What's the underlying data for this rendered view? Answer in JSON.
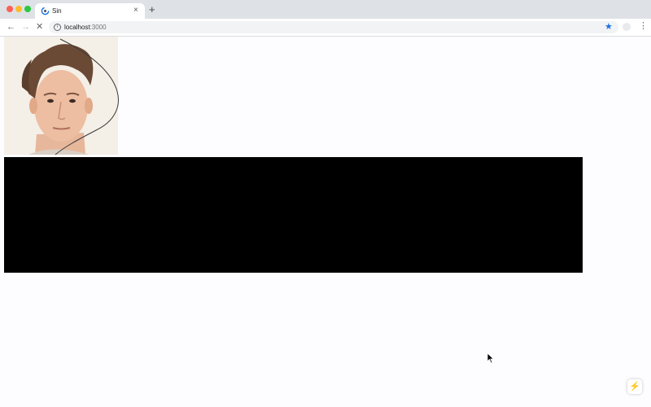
{
  "browser": {
    "tab": {
      "title": "Sin",
      "close_glyph": "×",
      "favicon": "loading-favicon-icon"
    },
    "new_tab_glyph": "+",
    "toolbar": {
      "back_glyph": "←",
      "forward_glyph": "→",
      "stop_glyph": "✕",
      "info_glyph": "i",
      "url_host": "localhost",
      "url_port": ":3000",
      "star_glyph": "★",
      "menu_glyph": "⋮"
    }
  },
  "page": {
    "bolt_glyph": "⚡",
    "colors": {
      "background": "#fdfcfe",
      "block": "#000000",
      "curve": "#3a3a3a"
    }
  }
}
